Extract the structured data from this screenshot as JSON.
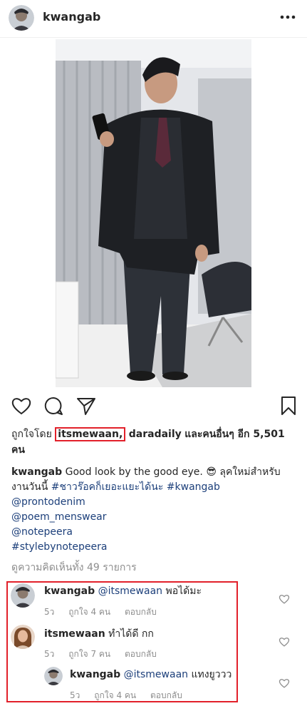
{
  "post": {
    "author": "kwangab",
    "more_label": "•••"
  },
  "likes": {
    "prefix": "ถูกใจโดย",
    "highlight_user": "itsmewaan,",
    "second_user": "daradaily",
    "suffix": "และคนอื่นๆ อีก 5,501",
    "suffix2": "คน"
  },
  "caption": {
    "user": "kwangab",
    "text": "Good look by the good eye. 😎 ลุคใหม่สำหรับงานวันนี้",
    "hashtag1": "#ชาวร๊อคก็เยอะแยะได้นะ",
    "hashtag2": "#kwangab",
    "mentions": [
      "@prontodenim",
      "@poem_menswear",
      "@notepeera",
      "#stylebynotepeera"
    ]
  },
  "view_all": "ดูความคิดเห็นทั้ง 49 รายการ",
  "comments": [
    {
      "user": "kwangab",
      "mention": "@itsmewaan",
      "text": "พอได้มะ",
      "time": "5ว",
      "likes": "ถูกใจ 4 คน",
      "reply": "ตอบกลับ"
    },
    {
      "user": "itsmewaan",
      "mention": "",
      "text": "ทำได้ดี กก",
      "time": "5ว",
      "likes": "ถูกใจ 7 คน",
      "reply": "ตอบกลับ"
    },
    {
      "user": "kwangab",
      "mention": "@itsmewaan",
      "text": "แทงยูววว",
      "time": "5ว",
      "likes": "ถูกใจ 4 คน",
      "reply": "ตอบกลับ"
    }
  ],
  "colors": {
    "highlight": "#e2202a",
    "link": "#1c3f7a",
    "muted": "#8e8e8e"
  }
}
